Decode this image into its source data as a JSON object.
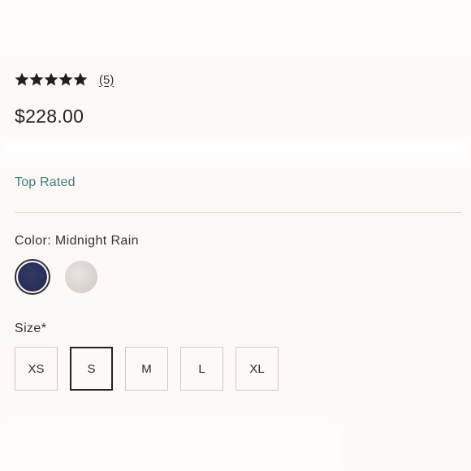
{
  "rating": {
    "stars": 5,
    "max_stars": 5,
    "review_count_label": "(5)"
  },
  "price": "$228.00",
  "badge": "Top Rated",
  "color": {
    "label": "Color: Midnight Rain",
    "swatches": [
      {
        "name": "Midnight Rain",
        "hex": "#262d55",
        "selected": true
      },
      {
        "name": "Light Grey",
        "hex": "#d8cfcd",
        "selected": false
      }
    ]
  },
  "size": {
    "label": "Size*",
    "options": [
      "XS",
      "S",
      "M",
      "L",
      "XL"
    ],
    "selected": "S"
  },
  "colors": {
    "background": "#fdf9f7",
    "accent_teal": "#3f7f7a",
    "star": "#1f1f1f"
  }
}
